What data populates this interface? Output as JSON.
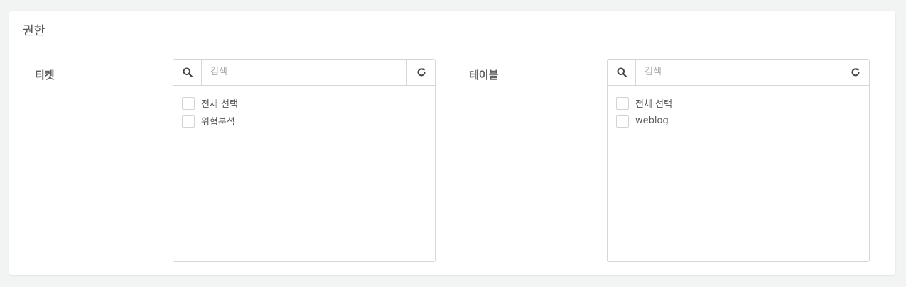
{
  "panel": {
    "title": "권한"
  },
  "ticket": {
    "label": "티켓",
    "search": {
      "placeholder": "검색",
      "value": ""
    },
    "items": [
      {
        "label": "전체 선택",
        "checked": false
      },
      {
        "label": "위협분석",
        "checked": false
      }
    ]
  },
  "table": {
    "label": "테이블",
    "search": {
      "placeholder": "검색",
      "value": ""
    },
    "items": [
      {
        "label": "전체 선택",
        "checked": false
      },
      {
        "label": "weblog",
        "checked": false
      }
    ]
  },
  "icons": {
    "search": "search-icon",
    "refresh": "refresh-icon"
  }
}
